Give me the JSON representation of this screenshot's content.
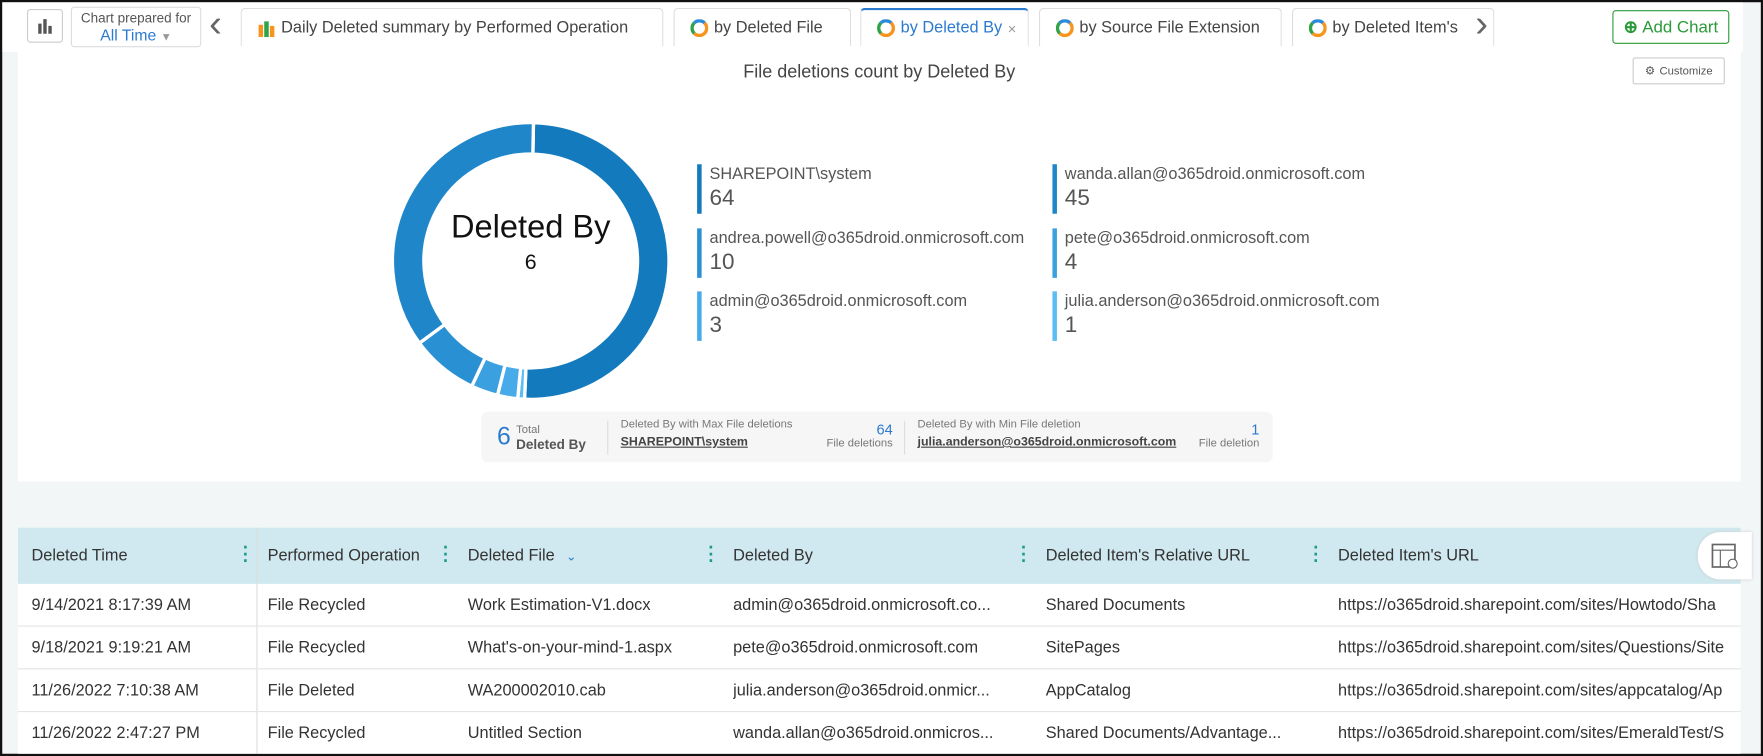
{
  "toolbar": {
    "prepared_label": "Chart prepared for",
    "prepared_value": "All Time",
    "add_chart": "Add Chart"
  },
  "tabs": [
    {
      "label": "Daily Deleted summary by Performed Operation",
      "icon": "bar-chart-icon"
    },
    {
      "label": "by Deleted File",
      "icon": "donut-icon"
    },
    {
      "label": "by Deleted By",
      "icon": "donut-icon",
      "active": true
    },
    {
      "label": "by Source File Extension",
      "icon": "donut-icon"
    },
    {
      "label": "by Deleted Item's",
      "icon": "donut-icon"
    }
  ],
  "chart": {
    "title": "File deletions count by Deleted By",
    "customize": "Customize",
    "center_label": "Deleted By",
    "center_value": "6"
  },
  "chart_data": {
    "type": "pie",
    "variant": "donut",
    "series": [
      {
        "name": "SHAREPOINT\\system",
        "value": 64,
        "color": "#137abd"
      },
      {
        "name": "julia.anderson@o365droid.onmicrosoft.com",
        "value": 1,
        "color": "#5cbdf4"
      },
      {
        "name": "admin@o365droid.onmicrosoft.com",
        "value": 3,
        "color": "#47aae9"
      },
      {
        "name": "pete@o365droid.onmicrosoft.com",
        "value": 4,
        "color": "#3ba0e0"
      },
      {
        "name": "andrea.powell@o365droid.onmicrosoft.com",
        "value": 10,
        "color": "#2a90d4"
      },
      {
        "name": "wanda.allan@o365droid.onmicrosoft.com",
        "value": 45,
        "color": "#1f86c9"
      }
    ]
  },
  "legend": [
    {
      "name": "SHAREPOINT\\system",
      "value": "64",
      "color": "#137abd"
    },
    {
      "name": "wanda.allan@o365droid.onmicrosoft.com",
      "value": "45",
      "color": "#1f86c9"
    },
    {
      "name": "andrea.powell@o365droid.onmicrosoft.com",
      "value": "10",
      "color": "#2a90d4"
    },
    {
      "name": "pete@o365droid.onmicrosoft.com",
      "value": "4",
      "color": "#3ba0e0"
    },
    {
      "name": "admin@o365droid.onmicrosoft.com",
      "value": "3",
      "color": "#47aae9"
    },
    {
      "name": "julia.anderson@o365droid.onmicrosoft.com",
      "value": "1",
      "color": "#5cbdf4"
    }
  ],
  "summary": {
    "total": "6",
    "total_label1": "Total",
    "total_label2": "Deleted By",
    "max_label": "Deleted By with Max File deletions",
    "max_name": "SHAREPOINT\\system",
    "max_value": "64",
    "max_unit": "File deletions",
    "min_label": "Deleted By with Min File deletion",
    "min_name": "julia.anderson@o365droid.onmicrosoft.com",
    "min_value": "1",
    "min_unit": "File deletion"
  },
  "table": {
    "columns": [
      "Deleted Time",
      "Performed Operation",
      "Deleted File",
      "Deleted By",
      "Deleted Item's Relative URL",
      "Deleted Item's URL"
    ],
    "rows": [
      [
        "9/14/2021 8:17:39 AM",
        "File Recycled",
        "Work Estimation-V1.docx",
        "admin@o365droid.onmicrosoft.co...",
        "Shared Documents",
        "https://o365droid.sharepoint.com/sites/Howtodo/Sha"
      ],
      [
        "9/18/2021 9:19:21 AM",
        "File Recycled",
        "What's-on-your-mind-1.aspx",
        "pete@o365droid.onmicrosoft.com",
        "SitePages",
        "https://o365droid.sharepoint.com/sites/Questions/Site"
      ],
      [
        "11/26/2022 7:10:38 AM",
        "File Deleted",
        "WA200002010.cab",
        "julia.anderson@o365droid.onmicr...",
        "AppCatalog",
        "https://o365droid.sharepoint.com/sites/appcatalog/Ap"
      ],
      [
        "11/26/2022 2:47:27 PM",
        "File Recycled",
        "Untitled Section",
        "wanda.allan@o365droid.onmicros...",
        "Shared Documents/Advantage...",
        "https://o365droid.sharepoint.com/sites/EmeraldTest/S"
      ]
    ]
  }
}
